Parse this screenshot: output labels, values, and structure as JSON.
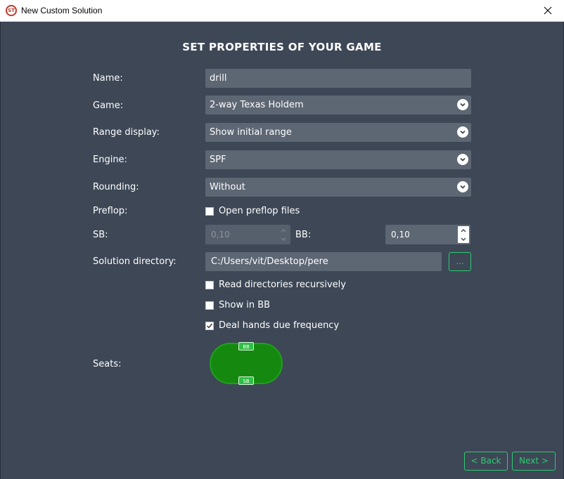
{
  "window": {
    "title": "New Custom Solution",
    "icon_text": "ST"
  },
  "heading": "SET PROPERTIES OF YOUR GAME",
  "form": {
    "name_label": "Name:",
    "name_value": "drill",
    "game_label": "Game:",
    "game_value": "2-way Texas Holdem",
    "range_label": "Range display:",
    "range_value": "Show initial range",
    "engine_label": "Engine:",
    "engine_value": "SPF",
    "rounding_label": "Rounding:",
    "rounding_value": "Without",
    "preflop_label": "Preflop:",
    "preflop_checkbox": "Open preflop files",
    "sb_label": "SB:",
    "sb_value": "0,10",
    "bb_label": "BB:",
    "bb_value": "0,10",
    "dir_label": "Solution directory:",
    "dir_value": "C:/Users/vit/Desktop/pere",
    "browse_label": "...",
    "recursive_checkbox": "Read directories recursively",
    "show_bb_checkbox": "Show in BB",
    "deal_checkbox": "Deal hands due frequency",
    "seats_label": "Seats:"
  },
  "checkboxes": {
    "preflop": false,
    "recursive": false,
    "show_bb": false,
    "deal": true
  },
  "seats": {
    "top": "BB",
    "bottom": "SB"
  },
  "footer": {
    "back_label": "< Back",
    "next_label": "Next >"
  },
  "colors": {
    "background": "#3d4756",
    "field": "#5d6673",
    "accent": "#2ecc71",
    "table": "#15890f"
  }
}
